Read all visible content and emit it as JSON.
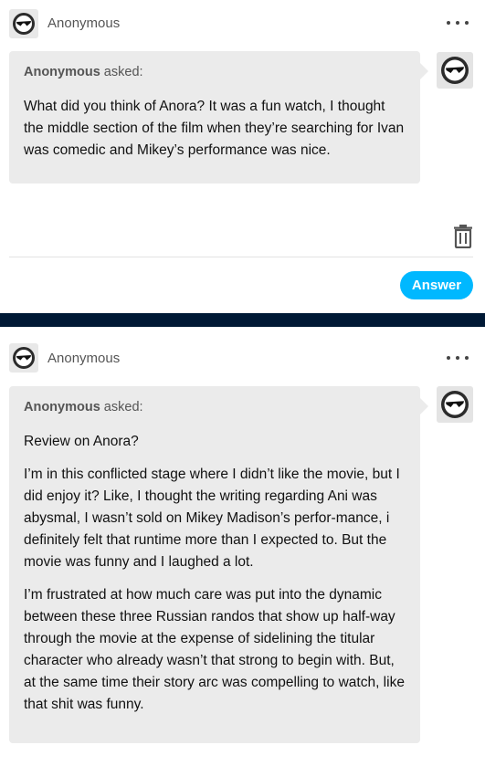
{
  "posts": [
    {
      "header": {
        "name": "Anonymous",
        "avatar_icon": "sunglasses-avatar-icon",
        "more_icon": "ellipsis-icon"
      },
      "ask": {
        "asker": "Anonymous",
        "asked_label": " asked:",
        "paragraphs": [
          "What did you think of Anora? It was a fun watch, I thought the middle section of the film when they’re searching for Ivan was comedic and Mikey’s performance was nice."
        ]
      },
      "actions": {
        "delete_icon": "trash-icon",
        "answer_label": "Answer"
      }
    },
    {
      "header": {
        "name": "Anonymous",
        "avatar_icon": "sunglasses-avatar-icon",
        "more_icon": "ellipsis-icon"
      },
      "ask": {
        "asker": "Anonymous",
        "asked_label": " asked:",
        "paragraphs": [
          "Review on Anora?",
          "I’m in this conflicted stage where I didn’t like the movie, but I did enjoy it? Like, I thought the writing regarding Ani was abysmal, I wasn’t sold on Mikey Madison’s perfor-mance, i definitely felt that runtime more than I expected to. But the movie was funny and I laughed a lot.",
          "I’m frustrated at how much care was put into the dynamic between these three Russian randos that show up half-way through the movie at the expense of sidelining the titular character who already wasn’t that strong to begin with. But, at the same time their story arc was compelling to watch, like that shit was funny."
        ]
      }
    }
  ],
  "colors": {
    "divider_band": "#001935",
    "answer_button": "#00b8ff",
    "bubble": "#ebebeb"
  }
}
